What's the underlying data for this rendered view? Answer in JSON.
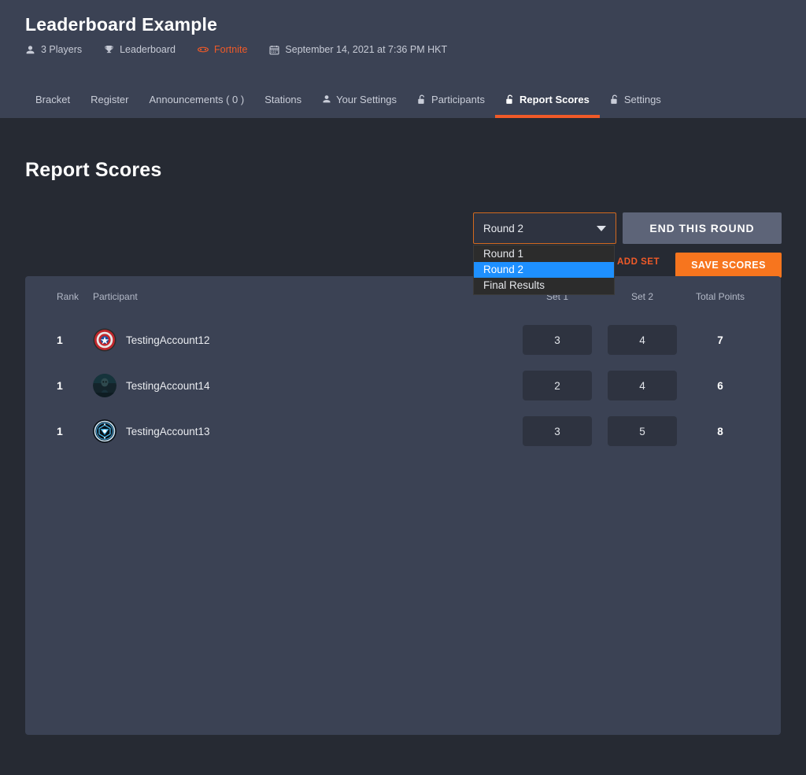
{
  "header": {
    "event_title": "Leaderboard Example",
    "meta": [
      {
        "icon": "user-icon",
        "label": "3 Players",
        "accent": false
      },
      {
        "icon": "trophy-icon",
        "label": "Leaderboard",
        "accent": false
      },
      {
        "icon": "gamepad-icon",
        "label": "Fortnite",
        "accent": true
      },
      {
        "icon": "calendar-icon",
        "label": "September 14, 2021 at 7:36 PM HKT",
        "accent": false
      }
    ]
  },
  "nav": {
    "tabs": [
      {
        "label": "Bracket",
        "icon": "",
        "active": false
      },
      {
        "label": "Register",
        "icon": "",
        "active": false
      },
      {
        "label": "Announcements ( 0 )",
        "icon": "",
        "active": false
      },
      {
        "label": "Stations",
        "icon": "",
        "active": false
      },
      {
        "label": "Your Settings",
        "icon": "user-icon",
        "active": false
      },
      {
        "label": "Participants",
        "icon": "unlock-icon",
        "active": false
      },
      {
        "label": "Report Scores",
        "icon": "unlock-icon",
        "active": true
      },
      {
        "label": "Settings",
        "icon": "unlock-icon",
        "active": false
      }
    ]
  },
  "main": {
    "page_title": "Report Scores",
    "round_select": {
      "value": "Round 2",
      "expanded": true,
      "options": [
        {
          "label": "Round 1",
          "selected": false
        },
        {
          "label": "Round 2",
          "selected": true
        },
        {
          "label": "Final Results",
          "selected": false
        }
      ]
    },
    "end_round_label": "END THIS ROUND",
    "add_set_label": "ADD SET",
    "save_scores_label": "SAVE SCORES",
    "table": {
      "headers": {
        "rank": "Rank",
        "participant": "Participant",
        "set1": "Set 1",
        "set2": "Set 2",
        "total": "Total Points"
      },
      "rows": [
        {
          "rank": "1",
          "name": "TestingAccount12",
          "avatar": "captain-america-shield-avatar",
          "set1": "3",
          "set2": "4",
          "total": "7"
        },
        {
          "rank": "1",
          "name": "TestingAccount14",
          "avatar": "dark-portrait-avatar",
          "set1": "2",
          "set2": "4",
          "total": "6"
        },
        {
          "rank": "1",
          "name": "TestingAccount13",
          "avatar": "arc-reactor-avatar",
          "set1": "3",
          "set2": "5",
          "total": "8"
        }
      ]
    }
  },
  "colors": {
    "accent": "#f05a28",
    "save_button": "#f7751e",
    "panel": "#3b4254",
    "page_bg": "#262a33",
    "dropdown_highlight": "#1e90ff"
  }
}
